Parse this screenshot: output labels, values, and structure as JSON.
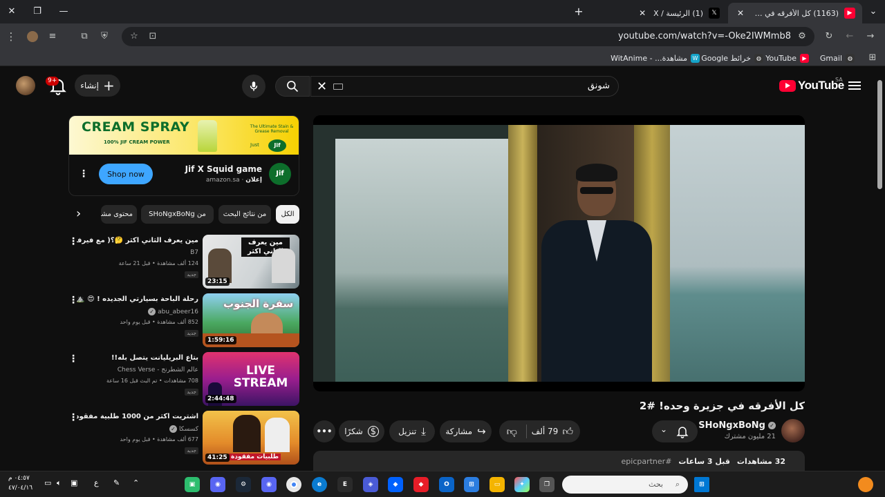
{
  "browser": {
    "tabs": [
      {
        "title": "(1163) كل الأفرقه في جزيرة وحده",
        "favicon": "youtube",
        "active": true
      },
      {
        "title": "(1) الرئيسة / X",
        "favicon": "x",
        "active": false
      }
    ],
    "new_tab_label": "+",
    "url": "youtube.com/watch?v=-Oke2IWMmb8",
    "bookmarks": [
      {
        "label": "Gmail",
        "icon": "gmail"
      },
      {
        "label": "YouTube",
        "icon": "youtube"
      },
      {
        "label": "خرائط Google",
        "icon": "maps"
      },
      {
        "label": "مشاهدة... - WitAnime",
        "icon": "witanime"
      }
    ]
  },
  "masthead": {
    "logo_text": "YouTube",
    "country_code": "SA",
    "search_query": "شونق",
    "create_label": "إنشاء",
    "notification_count": "9+"
  },
  "video": {
    "title": "كل الأفرقه في جزيرة وحده! #2",
    "channel": "SHoNgxBoNg",
    "subscribers": "21 مليون مشترك",
    "likes": "79 ألف",
    "share_label": "مشاركة",
    "download_label": "تنزيل",
    "thanks_label": "شكرًا",
    "views": "32 مشاهدات",
    "published": "قبل 3 ساعات",
    "hashtag": "#epicpartner"
  },
  "ad": {
    "banner_headline": "CREAM SPRAY",
    "banner_sub": "100% JIF CREAM POWER",
    "banner_tagline": "The Ultimate Stain & Grease Removal",
    "banner_brand": "Jif",
    "banner_just": "Just",
    "title": "Jif X Squid game",
    "label": "إعلان",
    "domain": "amazon.sa",
    "cta": "Shop now",
    "logo_text": "Jif"
  },
  "chips": [
    "الكل",
    "من نتائج البحث",
    "من SHoNgxBoNg",
    "محتوى مشا"
  ],
  "recommendations": [
    {
      "title": "مين يعرف الثاني اكثر 🤔؟( مع فيرفول 🔥 )",
      "channel": "B7",
      "verified": false,
      "meta": "124 ألف مشاهدة • قبل 21 ساعة",
      "badge": "جديد",
      "duration": "23:15",
      "thumb_text": "مين يعرف الثاني اكثر"
    },
    {
      "title": "رحلة الباحة بسيارتي الجديده ! 😍 ⛰️",
      "channel": "abu_abeer16",
      "verified": true,
      "meta": "852 ألف مشاهدة • قبل يوم واحد",
      "badge": "جديد",
      "duration": "1:59:16",
      "thumb_text": "سفرة الجنوب"
    },
    {
      "title": "بتاع البريليانت يتصل بله!!",
      "channel": "عالم الشطرنج - Chess Verse",
      "verified": false,
      "meta": "708 مشاهدات • تم البث قبل 16 ساعة",
      "badge": "جديد",
      "duration": "2:44:48",
      "thumb_text": "LIVE STREAM"
    },
    {
      "title": "اشتريت اكثر من 1000 طلبية مفقوده !!",
      "channel": "كسسكا",
      "verified": true,
      "meta": "677 ألف مشاهدة • قبل يوم واحد",
      "badge": "جديد",
      "duration": "41:25",
      "thumb_text": "طلبيات مفقودة"
    }
  ],
  "taskbar": {
    "search_placeholder": "بحث",
    "time": "٠٤:٥٧ م",
    "date": "٤٧/٠٤/١٦",
    "lang": "ع"
  }
}
